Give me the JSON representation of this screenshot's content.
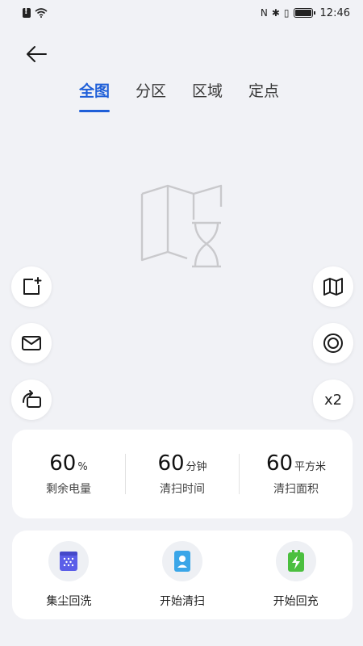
{
  "status_bar": {
    "time": "12:46",
    "nfc_glyph": "N",
    "bluetooth_glyph": "✱",
    "vibrate_glyph": "▯"
  },
  "header": {
    "back_icon": "arrow-left-icon"
  },
  "tabs": [
    {
      "label": "全图",
      "active": true
    },
    {
      "label": "分区",
      "active": false
    },
    {
      "label": "区域",
      "active": false
    },
    {
      "label": "定点",
      "active": false
    }
  ],
  "side_controls": {
    "left": [
      "edit-map-icon",
      "mail-icon",
      "rotate-icon"
    ],
    "right": [
      "map-icon",
      "target-icon",
      "zoom-x2"
    ],
    "zoom_label": "x2"
  },
  "stats": [
    {
      "value": "60",
      "unit": "%",
      "label": "剩余电量"
    },
    {
      "value": "60",
      "unit": "分钟",
      "label": "清扫时间"
    },
    {
      "value": "60",
      "unit": "平方米",
      "label": "清扫面积"
    }
  ],
  "actions": [
    {
      "label": "集尘回洗",
      "icon": "dust-collect-icon",
      "color": "#5b5ee8"
    },
    {
      "label": "开始清扫",
      "icon": "start-clean-icon",
      "color": "#3aa6e8"
    },
    {
      "label": "开始回充",
      "icon": "recharge-icon",
      "color": "#4bbf3f"
    }
  ],
  "colors": {
    "accent": "#1f5fd8",
    "background": "#f1f2f6"
  }
}
